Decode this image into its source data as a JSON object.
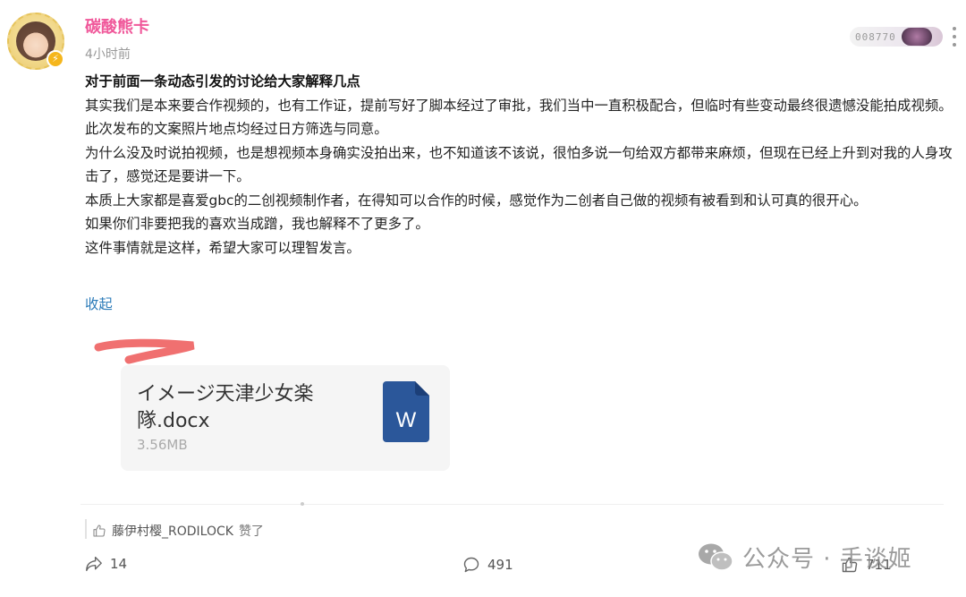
{
  "post": {
    "author": "碳酸熊卡",
    "time_ago": "4小时前",
    "fan_badge_number": "008770",
    "title": "对于前面一条动态引发的讨论给大家解释几点",
    "paragraphs": [
      "其实我们是本来要合作视频的，也有工作证，提前写好了脚本经过了审批，我们当中一直积极配合，但临时有些变动最终很遗憾没能拍成视频。",
      "此次发布的文案照片地点均经过日方筛选与同意。",
      "为什么没及时说拍视频，也是想视频本身确实没拍出来，也不知道该不该说，很怕多说一句给双方都带来麻烦，但现在已经上升到对我的人身攻击了，感觉还是要讲一下。",
      "本质上大家都是喜爱gbc的二创视频制作者，在得知可以合作的时候，感觉作为二创者自己做的视频有被看到和认可真的很开心。",
      "如果你们非要把我的喜欢当成蹭，我也解释不了更多了。",
      "这件事情就是这样，希望大家可以理智发言。"
    ],
    "collapse_label": "收起"
  },
  "attachment": {
    "file_name": "イメージ天津少女楽隊.docx",
    "file_size": "3.56MB",
    "icon": "word-document-icon",
    "icon_letter": "W",
    "icon_color": "#2b579a"
  },
  "likes": {
    "liker": "藤伊村樱_RODILOCK",
    "action": "赞了"
  },
  "footer": {
    "share_count": "14",
    "comment_count": "491",
    "like_count": "711"
  },
  "watermark": {
    "text": "公众号 · 手谈姬"
  },
  "colors": {
    "author": "#f0589a",
    "link": "#2a7ab8",
    "redaction": "#f07070"
  }
}
